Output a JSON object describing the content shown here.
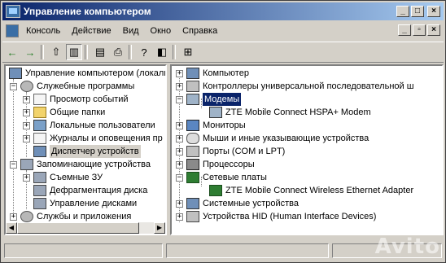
{
  "window": {
    "title": "Управление компьютером"
  },
  "menu": {
    "items": [
      "Консоль",
      "Действие",
      "Вид",
      "Окно",
      "Справка"
    ]
  },
  "left_tree": [
    {
      "label": "Управление компьютером (локальн"
    },
    {
      "label": "Служебные программы"
    },
    {
      "label": "Просмотр событий"
    },
    {
      "label": "Общие папки"
    },
    {
      "label": "Локальные пользователи"
    },
    {
      "label": "Журналы и оповещения пр"
    },
    {
      "label": "Диспетчер устройств"
    },
    {
      "label": "Запоминающие устройства"
    },
    {
      "label": "Съемные ЗУ"
    },
    {
      "label": "Дефрагментация диска"
    },
    {
      "label": "Управление дисками"
    },
    {
      "label": "Службы и приложения"
    }
  ],
  "right_tree": [
    {
      "label": "Компьютер"
    },
    {
      "label": "Контроллеры универсальной последовательной ш"
    },
    {
      "label": "Модемы"
    },
    {
      "label": "ZTE Mobile Connect HSPA+ Modem"
    },
    {
      "label": "Мониторы"
    },
    {
      "label": "Мыши и иные указывающие устройства"
    },
    {
      "label": "Порты (COM и LPT)"
    },
    {
      "label": "Процессоры"
    },
    {
      "label": "Сетевые платы"
    },
    {
      "label": "ZTE Mobile Connect Wireless Ethernet Adapter"
    },
    {
      "label": "Системные устройства"
    },
    {
      "label": "Устройства HID (Human Interface Devices)"
    }
  ],
  "watermark": "Avito",
  "colors": {
    "titlebar": "#0a246a",
    "face": "#d4d0c8",
    "selection": "#0a246a"
  }
}
